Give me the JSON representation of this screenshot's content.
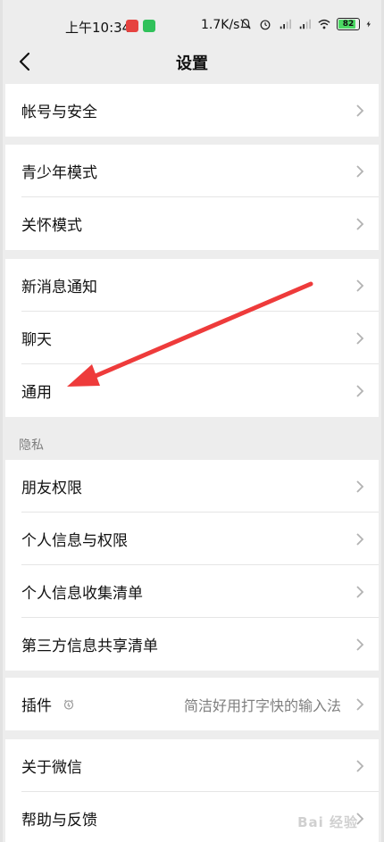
{
  "status_bar": {
    "time": "上午10:34",
    "net_speed": "1.7K/s",
    "battery_level": "82",
    "icons": [
      "mute-bell-icon",
      "alarm-icon",
      "signal-hd-icon",
      "signal-hd-icon",
      "wifi-icon",
      "battery-icon",
      "charging-icon"
    ]
  },
  "nav": {
    "title": "设置"
  },
  "groups": {
    "account": {
      "items": [
        {
          "label": "帐号与安全"
        }
      ]
    },
    "modes": {
      "items": [
        {
          "label": "青少年模式"
        },
        {
          "label": "关怀模式"
        }
      ]
    },
    "general": {
      "items": [
        {
          "label": "新消息通知"
        },
        {
          "label": "聊天"
        },
        {
          "label": "通用"
        }
      ]
    },
    "privacy": {
      "header": "隐私",
      "items": [
        {
          "label": "朋友权限"
        },
        {
          "label": "个人信息与权限"
        },
        {
          "label": "个人信息收集清单"
        },
        {
          "label": "第三方信息共享清单"
        }
      ]
    },
    "plugins": {
      "label": "插件",
      "value": "简洁好用打字快的输入法"
    },
    "about": {
      "items": [
        {
          "label": "关于微信"
        },
        {
          "label": "帮助与反馈"
        }
      ]
    }
  },
  "annotation": {
    "arrow_color": "#ee3b3b"
  },
  "watermark": "Bai 经验"
}
